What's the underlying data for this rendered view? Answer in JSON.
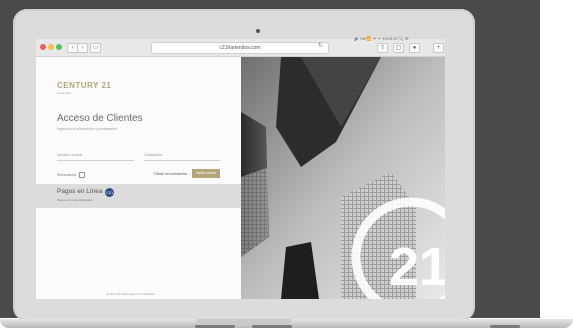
{
  "browser": {
    "url": "c21hartendos.com",
    "reload_icon": "↻",
    "menubar_text": "🔊 Vie 📶 ✦ ᯤ 14:19:37 🔍 ☰"
  },
  "page": {
    "brand": "CENTURY 21",
    "brand_sub": "Hartendos",
    "heading": "Acceso de Clientes",
    "subheading": "Ingresa a tu información y contratación",
    "username_placeholder": "Nombre Usuario",
    "password_placeholder": "Contraseña",
    "remember_label": "Recordarme",
    "forgot_label": "Olvidé mi contraseña",
    "login_button": "Iniciar sesión",
    "pay_title": "Pagos en Línea",
    "pay_sub": "Pagos en Línea Hartendos",
    "pay_badge": "C21",
    "footer": "Century 21 Hartendos © Inmobiliaria"
  },
  "colors": {
    "accent": "#b7a57a",
    "badge": "#2e4c86",
    "pay_band": "#dcdcdc"
  },
  "icons": {
    "camera": "camera-icon",
    "back": "back-icon",
    "forward": "forward-icon",
    "sidebar": "sidebar-icon",
    "share": "share-icon",
    "tabs": "tabs-icon",
    "extension": "extension-icon",
    "add_tab": "add-tab-icon",
    "century21_mark": "century21-logo"
  }
}
